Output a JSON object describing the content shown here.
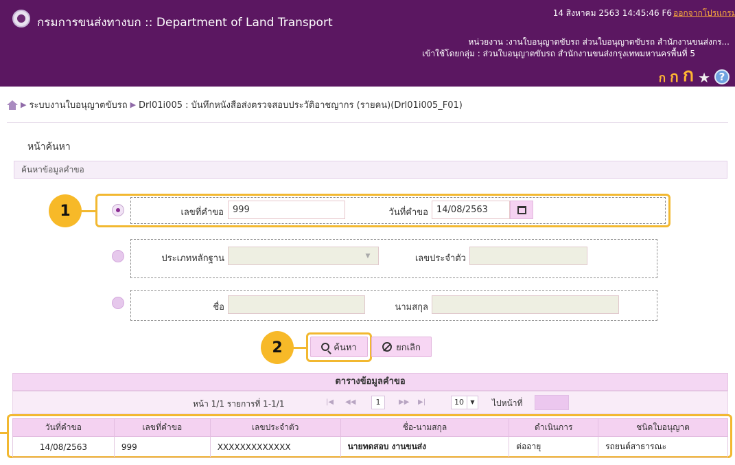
{
  "header": {
    "title": "กรมการขนส่งทางบก :: Department of Land Transport",
    "datetime": "14 สิงหาคม 2563 14:45:46 F6",
    "logout_label": "ออกจากโปรแกรม",
    "unit_line": "หน่วยงาน :งานใบอนุญาตขับรถ ส่วนใบอนุญาตขับรถ สำนักงานขนส่งกร...",
    "group_line": "เข้าใช้โดยกลุ่ม : ส่วนใบอนุญาตขับรถ สำนักงานขนส่งกรุงเทพมหานครพื้นที่ 5",
    "font_sizes": [
      "ก",
      "ก",
      "ก"
    ]
  },
  "breadcrumb": {
    "items": [
      "ระบบงานใบอนุญาตขับรถ",
      "Drl01i005 : บันทึกหนังสือส่งตรวจสอบประวัติอาชญากร (รายคน)(Drl01i005_F01)"
    ]
  },
  "page_title": "หน้าค้นหา",
  "section_title": "ค้นหาข้อมูลคำขอ",
  "search": {
    "request_no_label": "เลขที่คำขอ",
    "request_no_value": "999",
    "request_date_label": "วันที่คำขอ",
    "request_date_value": "14/08/2563",
    "doc_type_label": "ประเภทหลักฐาน",
    "id_no_label": "เลขประจำตัว",
    "first_name_label": "ชื่อ",
    "last_name_label": "นามสกุล",
    "search_button": "ค้นหา",
    "cancel_button": "ยกเลิก"
  },
  "callouts": [
    "1",
    "2"
  ],
  "results": {
    "title": "ตารางข้อมูลคำขอ",
    "pager_info": "หน้า 1/1 รายการที่ 1-1/1",
    "page_number": "1",
    "page_size": "10",
    "goto_label": "ไปหน้าที่",
    "columns": [
      "วันที่คำขอ",
      "เลขที่คำขอ",
      "เลขประจำตัว",
      "ชื่อ-นามสกุล",
      "ดำเนินการ",
      "ชนิดใบอนุญาต"
    ],
    "rows": [
      [
        "14/08/2563",
        "999",
        "XXXXXXXXXXXXX",
        "นายทดสอบ งานขนส่ง",
        "ต่ออายุ",
        "รถยนต์สาธารณะ"
      ]
    ]
  },
  "colors": {
    "header_bg": "#5b1761",
    "accent": "#f7b928",
    "button_bg": "#f7d6f3"
  },
  "icons": [
    "logo-icon",
    "home-icon",
    "star-icon",
    "help-icon",
    "calendar-icon",
    "search-icon",
    "cancel-icon"
  ]
}
